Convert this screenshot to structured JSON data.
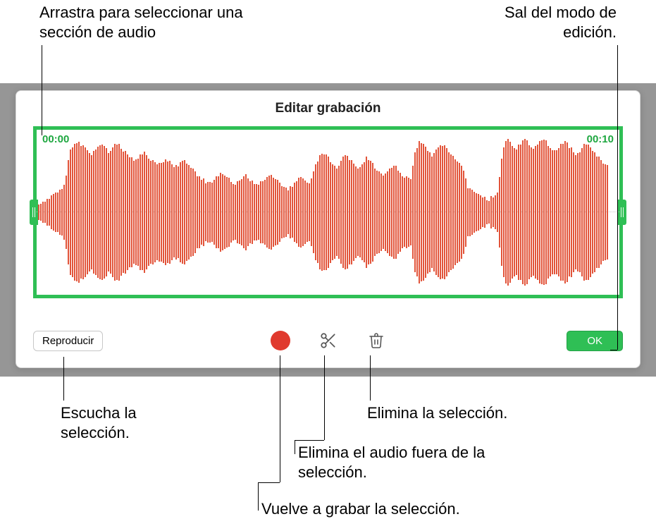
{
  "callouts": {
    "drag_select": "Arrastra para seleccionar una sección de audio",
    "exit_edit": "Sal del modo de edición.",
    "listen": "Escucha la selección.",
    "delete_sel": "Elimina la selección.",
    "trim_outside": "Elimina el audio fuera de la selección.",
    "rerecord": "Vuelve a grabar la selección."
  },
  "panel": {
    "title": "Editar grabación"
  },
  "wave": {
    "time_start": "00:00",
    "time_end": "00:10"
  },
  "toolbar": {
    "play_label": "Reproducir",
    "ok_label": "OK"
  },
  "icons": {
    "record": "record-icon",
    "scissors": "scissors-icon",
    "trash": "trash-icon"
  }
}
